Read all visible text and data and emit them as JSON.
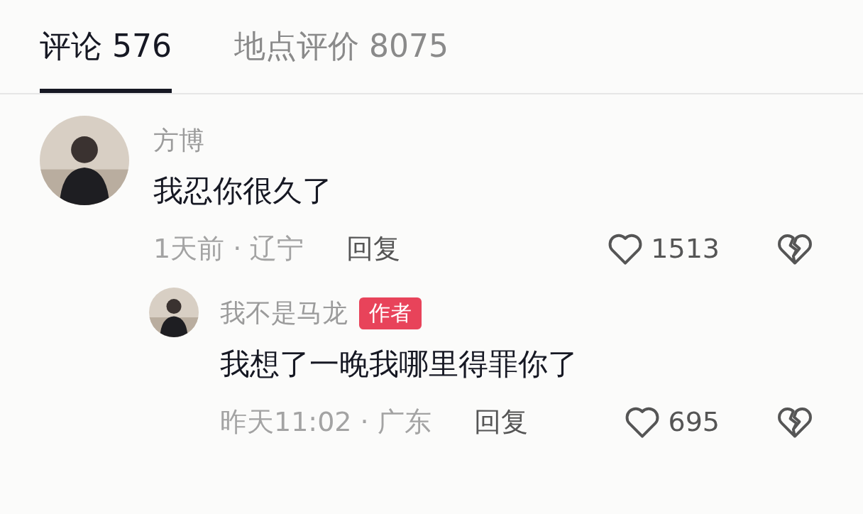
{
  "tabs": [
    {
      "label": "评论 576",
      "selected": true
    },
    {
      "label": "地点评价 8075",
      "selected": false
    }
  ],
  "comments": [
    {
      "name": "方博",
      "text": "我忍你很久了",
      "meta": "1天前 · 辽宁",
      "reply": "回复",
      "likes": "1513",
      "replies": [
        {
          "name": "我不是马龙",
          "badge": "作者",
          "text": "我想了一晚我哪里得罪你了",
          "meta": "昨天11:02 · 广东",
          "reply": "回复",
          "likes": "695"
        }
      ]
    }
  ]
}
